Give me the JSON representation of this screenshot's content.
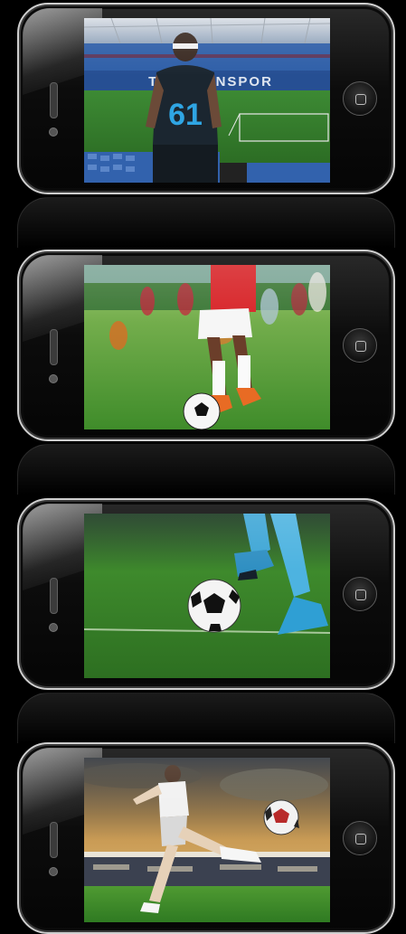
{
  "phones": [
    {
      "screen": {
        "jersey_number": "61",
        "banner_text": "TRABZONSPOR"
      }
    },
    {
      "screen": {}
    },
    {
      "screen": {}
    },
    {
      "screen": {}
    }
  ],
  "colors": {
    "background": "#000000",
    "bezel_border": "#cfcfcf",
    "grass": "#3f8c2a",
    "stadium_seats": "#2f5fa8"
  },
  "icons": {
    "home_button": "home-button-icon",
    "speaker": "speaker-grille-icon",
    "camera": "front-camera-icon"
  }
}
